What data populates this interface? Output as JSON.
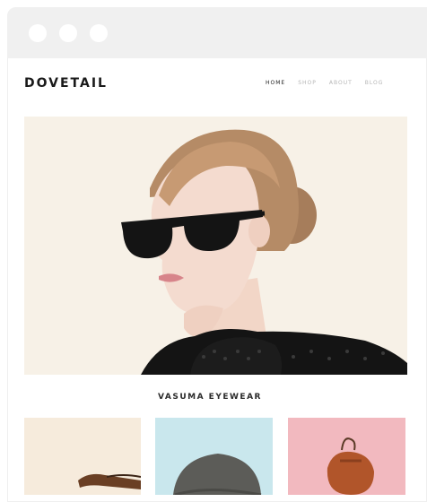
{
  "window": {
    "controls": [
      "close",
      "minimize",
      "zoom"
    ]
  },
  "header": {
    "brand": "DOVETAIL",
    "nav": [
      {
        "label": "HOME",
        "active": true
      },
      {
        "label": "SHOP",
        "active": false
      },
      {
        "label": "ABOUT",
        "active": false
      },
      {
        "label": "BLOG",
        "active": false
      }
    ]
  },
  "hero": {
    "background": "#f7f1e7"
  },
  "section": {
    "title": "VASUMA EYEWEAR"
  },
  "products": [
    {
      "background": "#f6ebdc",
      "item": "sunglasses"
    },
    {
      "background": "#c9e7ed",
      "item": "hat"
    },
    {
      "background": "#f2b9bf",
      "item": "bag"
    }
  ]
}
